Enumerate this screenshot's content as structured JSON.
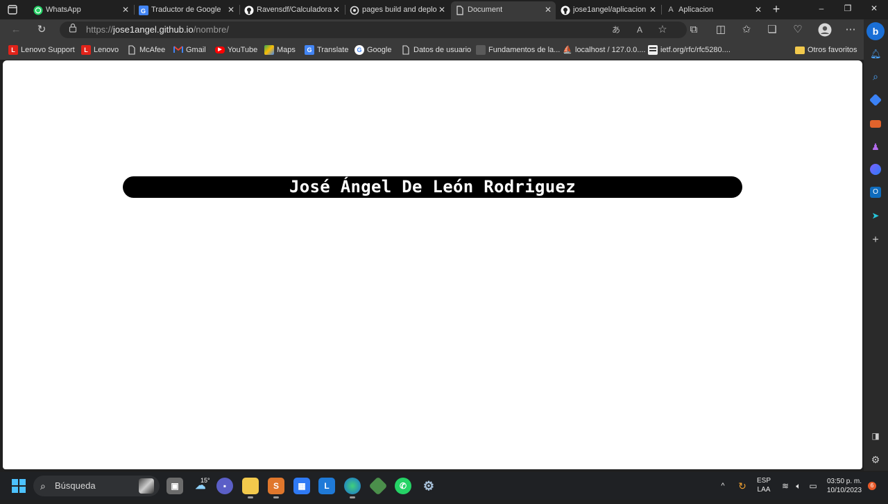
{
  "browser": {
    "tabs": [
      {
        "title": "WhatsApp",
        "favicon": "whatsapp-icon",
        "active": false
      },
      {
        "title": "Traductor de Google",
        "favicon": "google-translate-icon",
        "active": false
      },
      {
        "title": "Ravensdf/Calculadora",
        "favicon": "github-icon",
        "active": false
      },
      {
        "title": "pages build and deplo",
        "favicon": "github-actions-icon",
        "active": false
      },
      {
        "title": "Document",
        "favicon": "document-icon",
        "active": true
      },
      {
        "title": "jose1angel/aplicacion",
        "favicon": "github-icon",
        "active": false
      },
      {
        "title": "Aplicacion",
        "favicon": "letter-a-icon",
        "active": false
      }
    ],
    "close_glyph": "✕",
    "address": {
      "scheme": "https://",
      "host": "jose1angel.github.io",
      "path": "/nombre/"
    },
    "bookmarks": [
      {
        "label": "Lenovo Support",
        "icon": "lenovo-icon"
      },
      {
        "label": "Lenovo",
        "icon": "lenovo-icon"
      },
      {
        "label": "McAfee",
        "icon": "page-icon"
      },
      {
        "label": "Gmail",
        "icon": "gmail-icon"
      },
      {
        "label": "YouTube",
        "icon": "youtube-icon"
      },
      {
        "label": "Maps",
        "icon": "maps-icon"
      },
      {
        "label": "Translate",
        "icon": "translate-icon"
      },
      {
        "label": "Google",
        "icon": "google-icon"
      },
      {
        "label": "Datos de usuario",
        "icon": "page-icon"
      },
      {
        "label": "Fundamentos de la...",
        "icon": "bookmark-image-icon"
      },
      {
        "label": "localhost / 127.0.0....",
        "icon": "phpmyadmin-icon"
      },
      {
        "label": "ietf.org/rfc/rfc5280....",
        "icon": "ietf-icon"
      }
    ],
    "other_favorites": "Otros favoritos"
  },
  "page": {
    "name": "José Ángel De León Rodriguez"
  },
  "taskbar": {
    "search_label": "Búsqueda",
    "weather_temp": "15°",
    "language": "ESP",
    "layout": "LAA",
    "time": "03:50 p. m.",
    "date": "10/10/2023",
    "notification_count": "6"
  },
  "colors": {
    "banner_bg": "#000000",
    "banner_text": "#ffffff",
    "chrome_bg": "#3a3a3a",
    "taskbar_bg": "#1f2124",
    "accent": "#4cc2ff"
  }
}
